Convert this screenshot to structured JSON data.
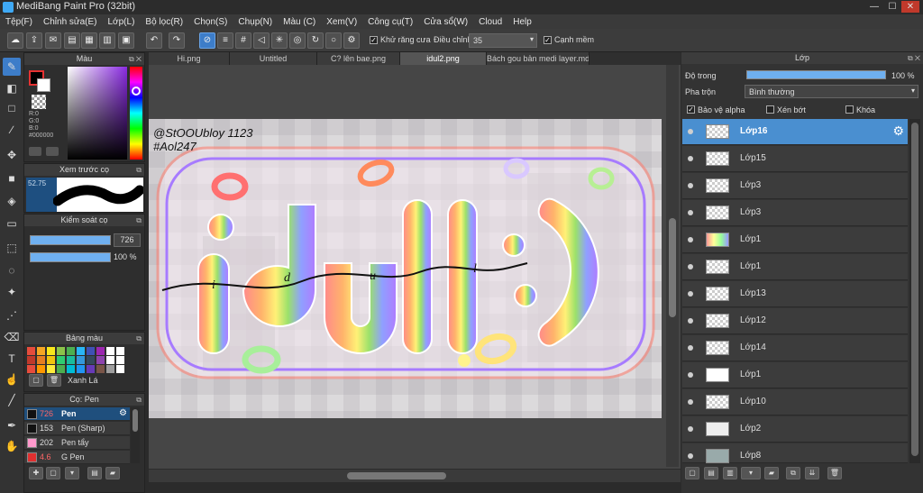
{
  "app": {
    "title": "MediBang Paint Pro (32bit)"
  },
  "window": {
    "minimize": "—",
    "maximize": "☐",
    "close": "✕"
  },
  "menu": [
    "Tệp(F)",
    "Chỉnh sửa(E)",
    "Lớp(L)",
    "Bộ lọc(R)",
    "Chọn(S)",
    "Chụp(N)",
    "Màu (C)",
    "Xem(V)",
    "Công cụ(T)",
    "Cửa sổ(W)",
    "Cloud",
    "Help"
  ],
  "toolbar": {
    "antialias_label": "Khử răng cưa",
    "adjust_label": "Điều chỉnh",
    "adjust_value": "35",
    "snap_label": "Cạnh mềm"
  },
  "tabs": [
    "Hi.png",
    "Untitled",
    "C? lên bae.png",
    "idul2.png",
    "Bách gou bản medi layer.mdp"
  ],
  "color_panel": {
    "title": "Màu",
    "r": "R:0",
    "g": "G:0",
    "b": "B:0",
    "hex": "#000000"
  },
  "brush_preview": {
    "title": "Xem trước cọ",
    "size": "52.75"
  },
  "brush_control": {
    "title": "Kiểm soát cọ",
    "size": "726",
    "opacity": "100 %"
  },
  "palette": {
    "title": "Bảng màu",
    "colors": [
      "#e64c3c",
      "#f5a623",
      "#f8e71c",
      "#8bc34a",
      "#4caf50",
      "#29b6f6",
      "#3f51b5",
      "#9c27b0",
      "#ffffff",
      "#ffffff",
      "#c0392b",
      "#e67e22",
      "#f1c40f",
      "#2ecc71",
      "#1abc9c",
      "#3498db",
      "#34495e",
      "#8e44ad",
      "#ffffff",
      "#ffffff",
      "#e74c3c",
      "#ff9800",
      "#ffeb3b",
      "#4caf50",
      "#00bcd4",
      "#2196f3",
      "#673ab7",
      "#795548",
      "#9e9e9e",
      "#ffffff"
    ],
    "selected_name": "Xanh Lá"
  },
  "brush_panel": {
    "title": "Cọ: Pen",
    "items": [
      {
        "size": "726",
        "name": "Pen",
        "color": "#111111",
        "active": true
      },
      {
        "size": "153",
        "name": "Pen (Sharp)",
        "color": "#111111"
      },
      {
        "size": "202",
        "name": "Pen tẩy",
        "color": "#ff99cc"
      },
      {
        "size": "4.6",
        "name": "G Pen",
        "color": "#e03030"
      }
    ]
  },
  "artwork": {
    "handle": "@StOOUbloy 1123",
    "tag": "#Aol247",
    "word": "idul:)",
    "script_letters": [
      "i",
      "d",
      "u",
      "l"
    ]
  },
  "layer_panel": {
    "title": "Lớp",
    "opacity_label": "Độ trong",
    "opacity_value": "100 %",
    "blend_label": "Pha trộn",
    "blend_value": "Bình thường",
    "protect_alpha": "Bảo vệ alpha",
    "clip": "Xén bớt",
    "lock": "Khóa",
    "layers": [
      "Lớp16",
      "Lớp15",
      "Lớp3",
      "Lớp3",
      "Lớp1",
      "Lớp1",
      "Lớp13",
      "Lớp12",
      "Lớp14",
      "Lớp1",
      "Lớp10",
      "Lớp2",
      "Lớp8"
    ]
  },
  "colors": {
    "accent": "#4a8fd0",
    "bg": "#2b2b2b"
  }
}
